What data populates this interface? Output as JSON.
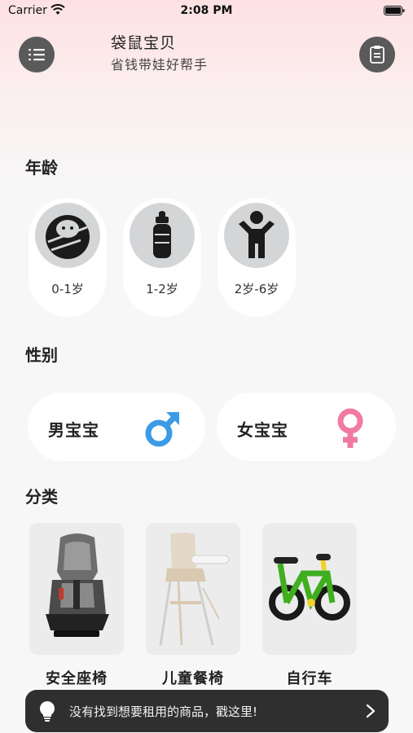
{
  "status": {
    "carrier": "Carrier",
    "time": "2:08 PM"
  },
  "header": {
    "title": "袋鼠宝贝",
    "subtitle": "省钱带娃好帮手",
    "menu_icon": "list-icon",
    "clipboard_icon": "clipboard-icon"
  },
  "age": {
    "title": "年龄",
    "items": [
      {
        "label": "0-1岁",
        "icon": "swaddled-baby-icon"
      },
      {
        "label": "1-2岁",
        "icon": "baby-bottle-icon"
      },
      {
        "label": "2岁-6岁",
        "icon": "child-icon"
      }
    ]
  },
  "gender": {
    "title": "性别",
    "items": [
      {
        "label": "男宝宝",
        "icon": "male-symbol-icon",
        "color": "#3d9be6"
      },
      {
        "label": "女宝宝",
        "icon": "female-symbol-icon",
        "color": "#f07aa2"
      }
    ]
  },
  "category": {
    "title": "分类",
    "items": [
      {
        "label": "安全座椅",
        "icon": "car-seat-image"
      },
      {
        "label": "儿童餐椅",
        "icon": "high-chair-image"
      },
      {
        "label": "自行车",
        "icon": "bicycle-image"
      }
    ]
  },
  "banner": {
    "text": "没有找到想要租用的商品，戳这里!",
    "icon": "lightbulb-icon"
  }
}
